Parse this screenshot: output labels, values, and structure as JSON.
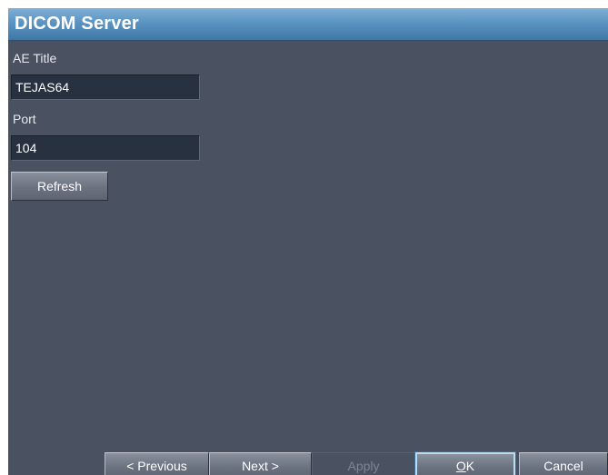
{
  "window": {
    "title": "DICOM Server"
  },
  "form": {
    "ae_title": {
      "label": "AE Title",
      "value": "TEJAS64"
    },
    "port": {
      "label": "Port",
      "value": "104"
    },
    "refresh_label": "Refresh"
  },
  "footer": {
    "previous_label": "< Previous",
    "next_label": "Next >",
    "apply_label": "Apply",
    "ok_mnemonic": "O",
    "ok_rest": "K",
    "cancel_label": "Cancel"
  },
  "colors": {
    "panel_background": "#4a5261",
    "title_bar": "#5b94c2",
    "field_background": "#283140",
    "text": "#ffffff"
  }
}
